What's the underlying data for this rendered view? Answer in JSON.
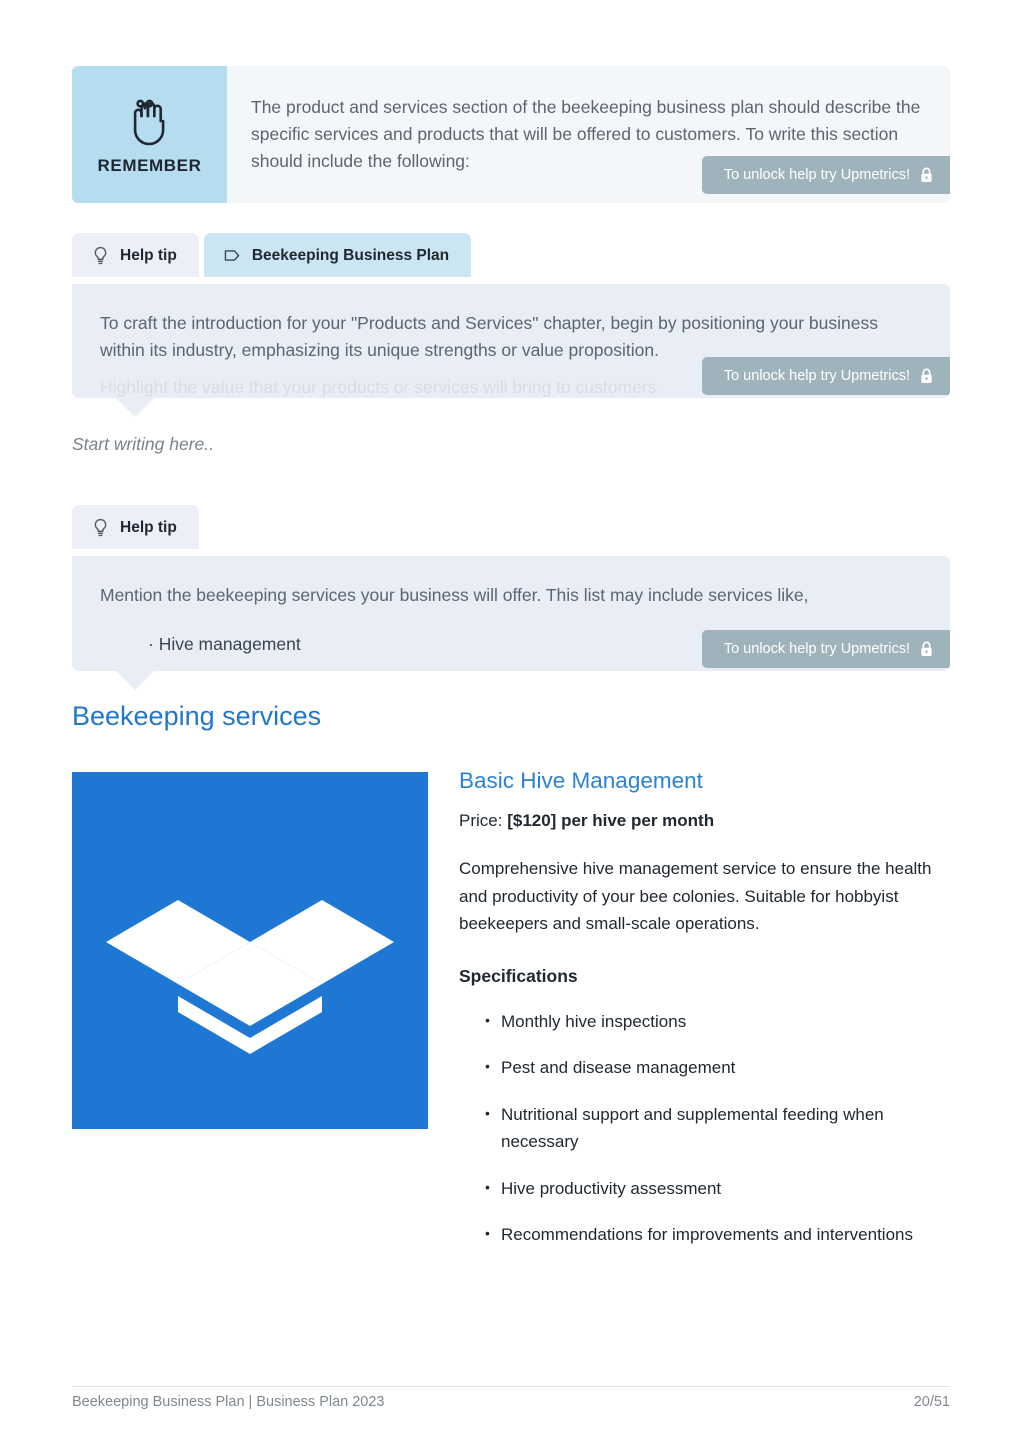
{
  "remember": {
    "label": "REMEMBER",
    "icon": "hand-reminder-string-icon",
    "body": "The product and services section of the beekeeping business plan should describe the specific services and products that will be offered to customers. To write this section should include the following:",
    "badge": "To unlock help try Upmetrics!"
  },
  "tip_one": {
    "tabs": [
      {
        "label": "Help tip",
        "icon": "lightbulb-icon",
        "active": false
      },
      {
        "label": "Beekeeping Business Plan",
        "icon": "tag-icon",
        "active": true
      }
    ],
    "body": "To craft the introduction for your \"Products and Services\" chapter, begin by positioning your business within its industry, emphasizing its unique strengths or value proposition.",
    "hidden_line": "Highlight the value that your products or services will bring to customers.",
    "badge": "To unlock help try Upmetrics!"
  },
  "write_placeholder": "Start writing here..",
  "tip_two": {
    "tabs": [
      {
        "label": "Help tip",
        "icon": "lightbulb-icon",
        "active": false
      }
    ],
    "body": "Mention the beekeeping services your business will offer. This list may include services like,",
    "bullet": "· Hive management",
    "badge": "To unlock help try Upmetrics!"
  },
  "section": {
    "heading": "Beekeeping services"
  },
  "service": {
    "image_icon": "dropbox-logo",
    "image_bg_color": "#1e77d3",
    "title": "Basic Hive Management",
    "price_label": "Price:",
    "price_value": "[$120] per hive per month",
    "description": "Comprehensive hive management service to ensure the health and productivity of your bee colonies. Suitable for hobbyist beekeepers and small-scale operations.",
    "spec_heading": "Specifications",
    "specs": [
      "Monthly hive inspections",
      "Pest and disease management",
      "Nutritional support and supplemental feeding when necessary",
      "Hive productivity assessment",
      "Recommendations for improvements and interventions"
    ]
  },
  "footer": {
    "left": "Beekeeping Business Plan | Business Plan 2023",
    "right": "20/51"
  },
  "colors": {
    "heading_blue": "#2277c8",
    "service_title_blue": "#2b82d4",
    "remember_panel": "#b6dcef",
    "tip_panel": "#e9edf5",
    "badge": "#9fb3bd",
    "dropbox_blue": "#1e77d3"
  }
}
